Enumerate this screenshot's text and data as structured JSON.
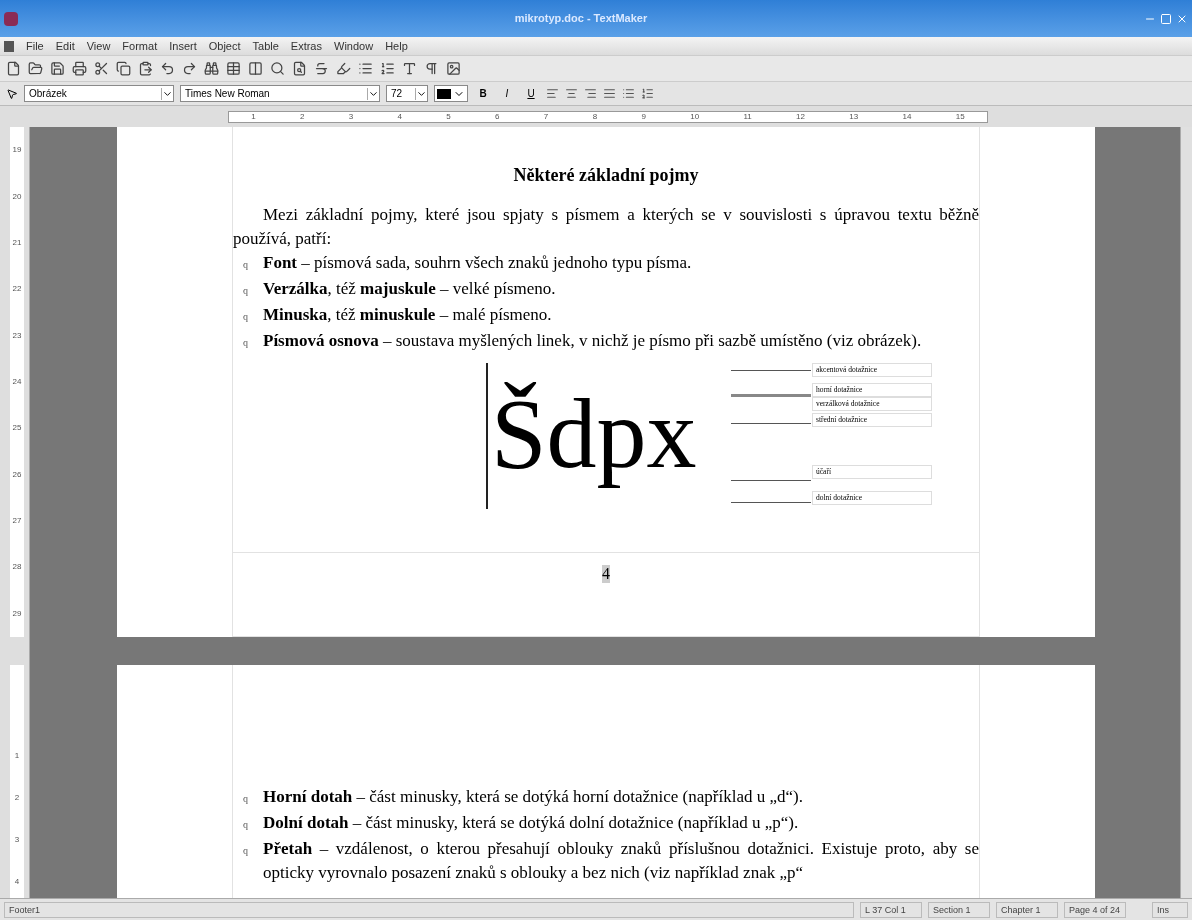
{
  "window": {
    "title": "mikrotyp.doc - TextMaker"
  },
  "menu": [
    "File",
    "Edit",
    "View",
    "Format",
    "Insert",
    "Object",
    "Table",
    "Extras",
    "Window",
    "Help"
  ],
  "format_bar": {
    "style": "Obrázek",
    "font": "Times New Roman",
    "size": "72",
    "buttons": [
      "B",
      "I",
      "U"
    ]
  },
  "ruler": {
    "marks": [
      "1",
      "2",
      "3",
      "4",
      "5",
      "6",
      "7",
      "8",
      "9",
      "10",
      "11",
      "12",
      "13",
      "14",
      "15"
    ]
  },
  "vertical_ruler": {
    "page1": [
      "19",
      "20",
      "21",
      "22",
      "23",
      "24",
      "25",
      "26",
      "27",
      "28",
      "29"
    ],
    "page2": [
      "1",
      "2",
      "3",
      "4"
    ]
  },
  "page1": {
    "heading": "Některé základní pojmy",
    "paragraph": "Mezi základní pojmy, které jsou spjaty s písmem a kterých se v souvislosti s úpravou textu běžně používá, patří:",
    "items": [
      {
        "bullet": "q",
        "text": "**Font** – písmová sada, souhrn všech znaků jednoho typu písma."
      },
      {
        "bullet": "q",
        "text": "**Verzálka**, též **majuskule** – velké písmeno."
      },
      {
        "bullet": "q",
        "text": "**Minuska**, též **minuskule** – malé písmeno."
      },
      {
        "bullet": "q",
        "text": "**Písmová osnova** – soustava myšlených linek, v nichž je písmo při sazbě umístěno (viz obrázek)."
      }
    ],
    "figure": {
      "sample": "Šdpx",
      "labels": [
        "akcentová dotažnice",
        "horní dotažnice",
        "verzálková dotažnice",
        "střední dotažnice",
        "účaří",
        "dolní dotažnice"
      ]
    },
    "page_number": "4"
  },
  "page2": {
    "items": [
      {
        "bullet": "q",
        "text": "**Horní dotah** – část minusky, která se dotýká horní dotažnice (například u „d“)."
      },
      {
        "bullet": "q",
        "text": "**Dolní dotah** – část minusky, která se dotýká dolní dotažnice (například u „p“)."
      },
      {
        "bullet": "q",
        "text": "**Přetah** – vzdálenost, o kterou přesahují oblouky znaků příslušnou dotažnici. Existuje proto, aby se opticky vyrovnalo posazení znaků s oblouky a bez nich (viz například znak „p“"
      }
    ]
  },
  "status_bar": [
    "Footer1",
    "L 37 Col 1",
    "Section 1",
    "Chapter 1",
    "Page 4 of 24",
    "Ins"
  ]
}
